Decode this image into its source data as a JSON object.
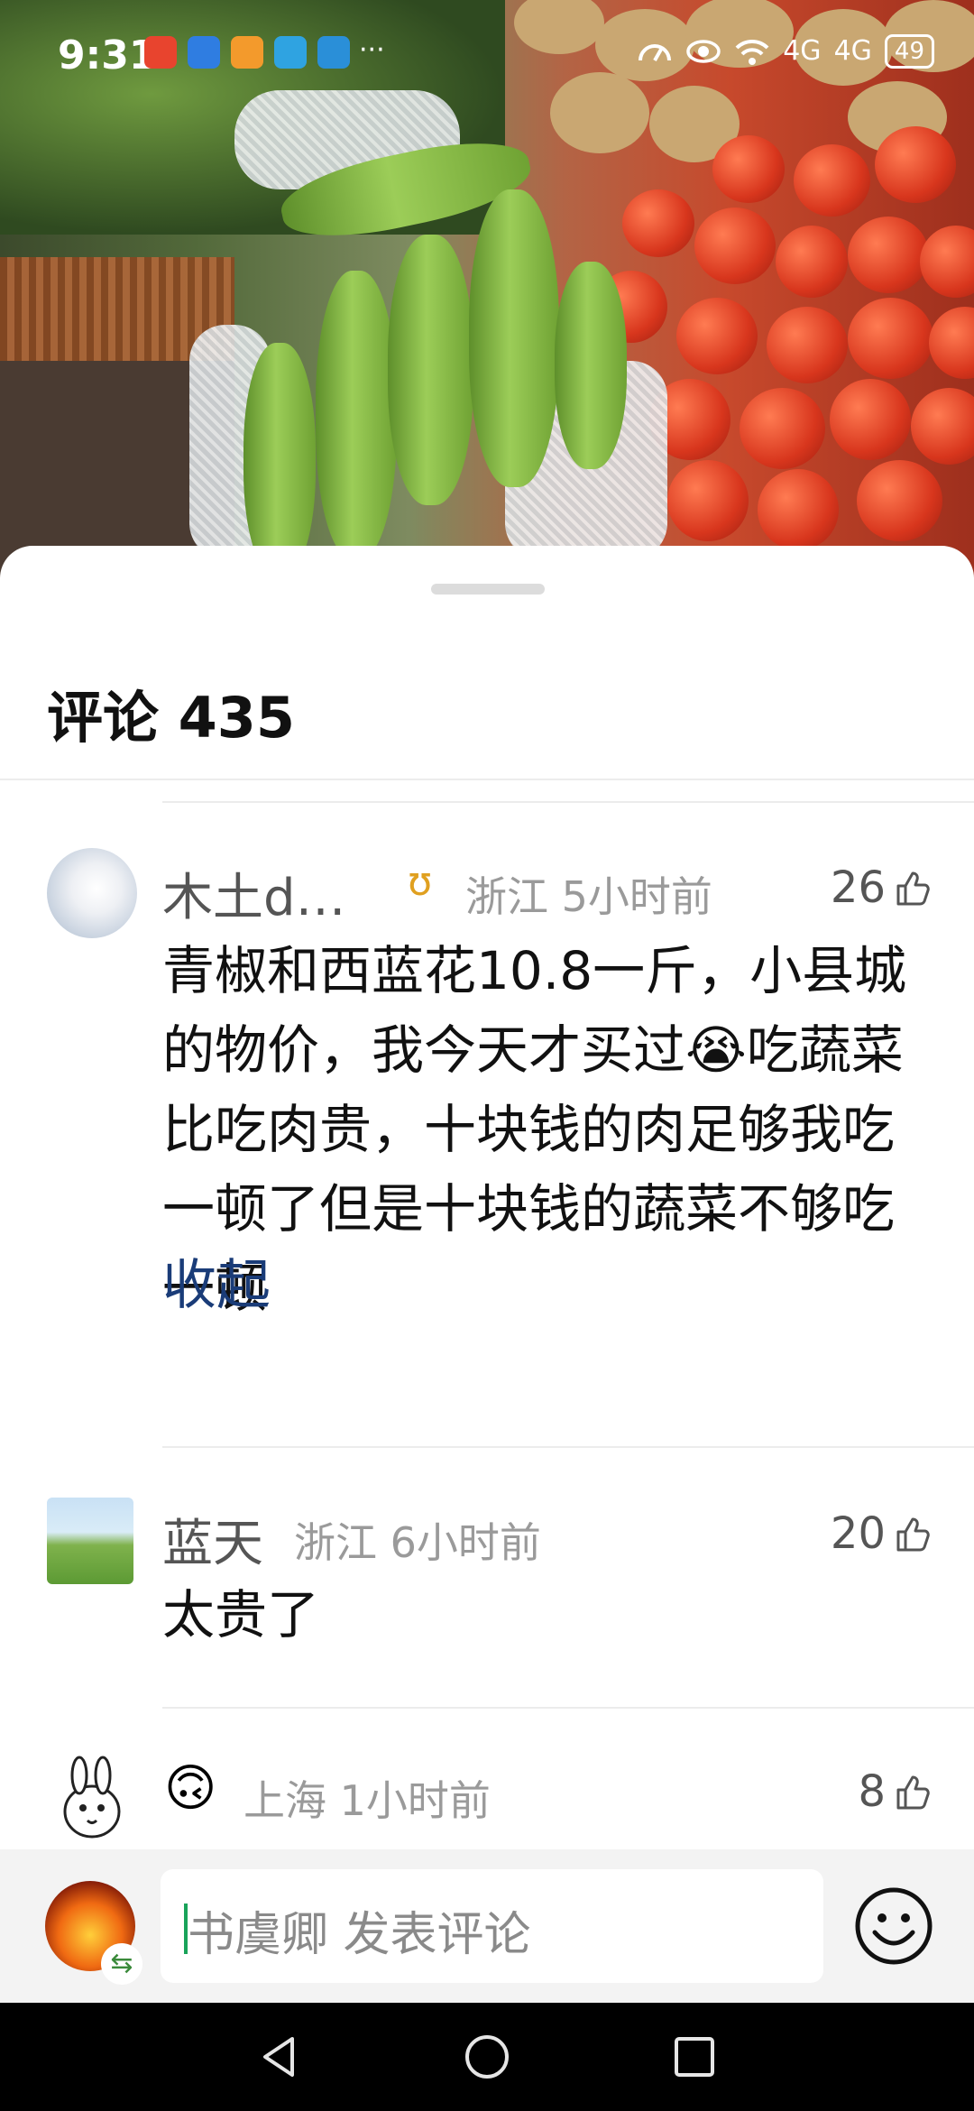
{
  "status_bar": {
    "time": "9:31",
    "more": "···",
    "network_1": "4G",
    "network_2": "4G",
    "battery": "49"
  },
  "comments_panel": {
    "title": "评论 435",
    "comments": [
      {
        "user": "木土d…",
        "location_time": "浙江 5小时前",
        "likes": "26",
        "text": "青椒和西蓝花10.8一斤，小县城的物价，我今天才买过😭吃蔬菜比吃肉贵，十块钱的肉足够我吃一顿了但是十块钱的蔬菜不够吃一顿",
        "collapse_label": "收起"
      },
      {
        "user": "蓝天",
        "location_time": "浙江 6小时前",
        "likes": "20",
        "text": "太贵了"
      },
      {
        "user": "🙃",
        "location_time": "上海 1小时前",
        "likes": "8"
      }
    ]
  },
  "input_bar": {
    "placeholder": "书虞卿 发表评论",
    "switch_icon": "⇆"
  },
  "colors": {
    "link": "#1a3c78",
    "caret": "#19a35a",
    "badge": "#e0a020"
  }
}
